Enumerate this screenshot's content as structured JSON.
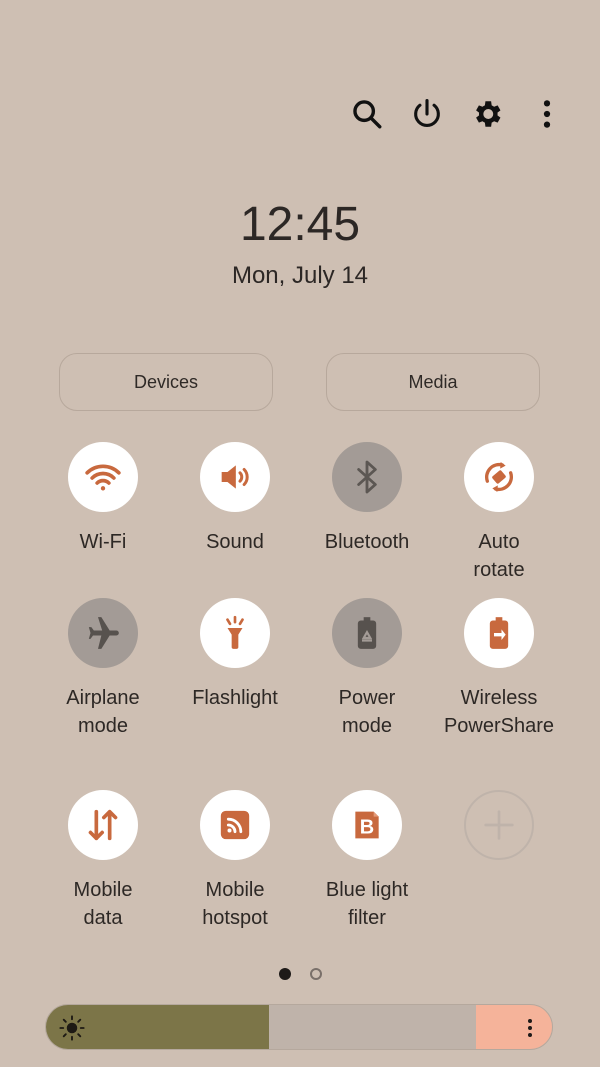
{
  "header": {
    "icons": [
      {
        "name": "search-icon"
      },
      {
        "name": "power-icon"
      },
      {
        "name": "settings-gear-icon"
      },
      {
        "name": "more-options-icon"
      }
    ]
  },
  "clock": {
    "time": "12:45",
    "date": "Mon, July 14"
  },
  "buttons": {
    "devices": "Devices",
    "media": "Media"
  },
  "tiles": [
    {
      "label": "Wi-Fi",
      "state": "on"
    },
    {
      "label": "Sound",
      "state": "on"
    },
    {
      "label": "Bluetooth",
      "state": "off"
    },
    {
      "label": "Auto\nrotate",
      "state": "on"
    },
    {
      "label": "Airplane\nmode",
      "state": "off"
    },
    {
      "label": "Flashlight",
      "state": "on"
    },
    {
      "label": "Power\nmode",
      "state": "off"
    },
    {
      "label": "Wireless\nPowerShare",
      "state": "on"
    },
    {
      "label": "Mobile\ndata",
      "state": "on"
    },
    {
      "label": "Mobile\nhotspot",
      "state": "on"
    },
    {
      "label": "Blue light\nfilter",
      "state": "on"
    },
    {
      "label": "",
      "state": "add"
    }
  ],
  "pager": {
    "current_page": 1,
    "total_pages": 2
  },
  "brightness": {
    "level": 0.44
  },
  "colors": {
    "background": "#cebfb3",
    "accent": "#c8693e",
    "tile_off": "#a39b96",
    "brightness_fill": "#7c7548",
    "brightness_end": "#f5b39a"
  }
}
